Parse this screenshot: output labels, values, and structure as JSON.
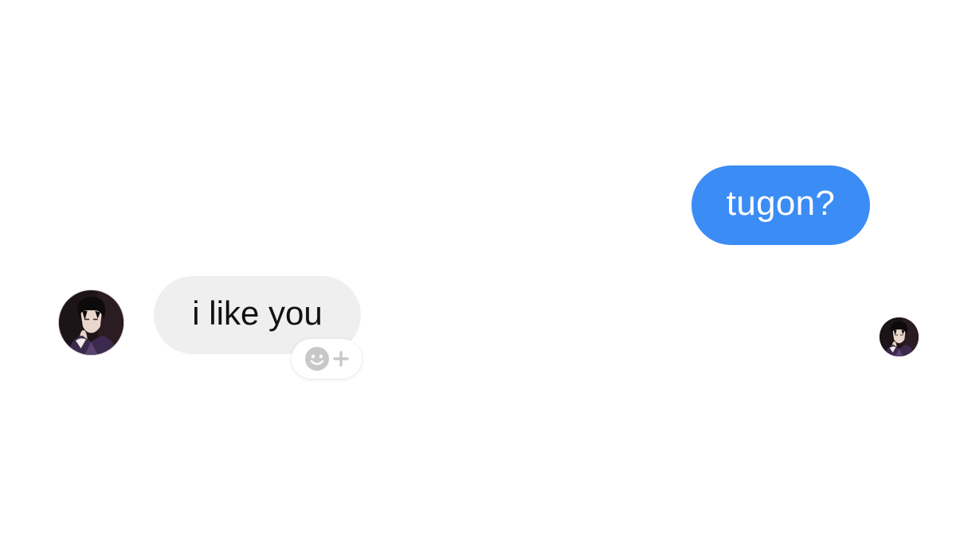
{
  "conversation": {
    "messages": [
      {
        "direction": "outgoing",
        "text": "tugon?"
      },
      {
        "direction": "incoming",
        "text": "i like you"
      }
    ],
    "reaction_button": {
      "icons": [
        "smiley-face-icon",
        "plus-icon"
      ]
    },
    "avatars": {
      "incoming_sender": {
        "icon": "profile-photo-avatar"
      },
      "read_receipt": {
        "icon": "profile-photo-avatar"
      }
    }
  },
  "colors": {
    "sent_bubble": "#3b8cf5",
    "sent_text": "#ffffff",
    "received_bubble": "#efefef",
    "received_text": "#111111",
    "background": "#ffffff",
    "reaction_icon": "#c8c8c8"
  }
}
